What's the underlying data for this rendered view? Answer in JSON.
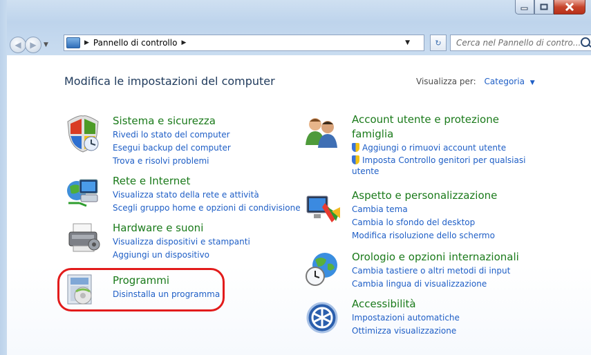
{
  "window": {
    "buttons": [
      "minimize",
      "maximize",
      "close"
    ]
  },
  "address_bar": {
    "crumbs": [
      "Pannello di controllo"
    ],
    "search_placeholder": "Cerca nel Pannello di contro..."
  },
  "page": {
    "heading": "Modifica le impostazioni del computer",
    "view_by_label": "Visualizza per:",
    "view_by_value": "Categoria"
  },
  "categories": [
    {
      "title": "Sistema e sicurezza",
      "icon": "shield-icon",
      "links": [
        "Rivedi lo stato del computer",
        "Esegui backup del computer",
        "Trova e risolvi problemi"
      ]
    },
    {
      "title": "Rete e Internet",
      "icon": "network-icon",
      "links": [
        "Visualizza stato della rete e attività",
        "Scegli gruppo home e opzioni di condivisione"
      ]
    },
    {
      "title": "Hardware e suoni",
      "icon": "printer-icon",
      "links": [
        "Visualizza dispositivi e stampanti",
        "Aggiungi un dispositivo"
      ]
    },
    {
      "title": "Programmi",
      "icon": "programs-icon",
      "links": [
        "Disinstalla un programma"
      ]
    },
    {
      "title": "Account utente e protezione",
      "title2": "famiglia",
      "icon": "users-icon",
      "links": [
        "Aggiungi o rimuovi account utente",
        "Imposta Controllo genitori per qualsiasi",
        "utente"
      ]
    },
    {
      "title": "Aspetto e personalizzazione",
      "icon": "display-icon",
      "links": [
        "Cambia tema",
        "Cambia lo sfondo del desktop",
        "Modifica risoluzione dello schermo"
      ]
    },
    {
      "title": "Orologio e opzioni internazionali",
      "icon": "globe-clock-icon",
      "links": [
        "Cambia tastiere o altri metodi di input",
        "Cambia lingua di visualizzazione"
      ]
    },
    {
      "title": "Accessibilità",
      "icon": "accessibility-icon",
      "links": [
        "Impostazioni automatiche",
        "Ottimizza visualizzazione"
      ]
    }
  ],
  "colors": {
    "category_title": "#1a7a1a",
    "link": "#1e5ec6",
    "heading": "#1e395b",
    "highlight": "#e21b1b"
  }
}
